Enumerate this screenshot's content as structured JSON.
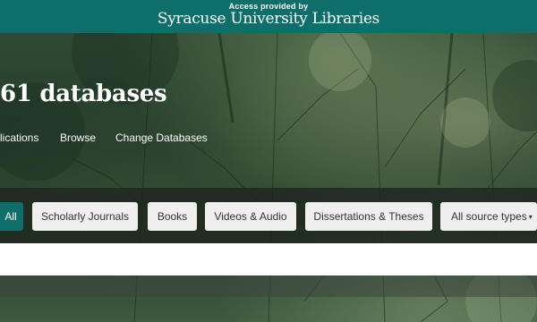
{
  "access": {
    "provided_by": "Access provided by",
    "institution": "Syracuse University Libraries"
  },
  "hero": {
    "title": "61 databases"
  },
  "nav": {
    "items": [
      {
        "label": "lications"
      },
      {
        "label": "Browse"
      },
      {
        "label": "Change Databases"
      }
    ]
  },
  "filters": {
    "items": [
      {
        "label": "All",
        "active": true
      },
      {
        "label": "Scholarly Journals"
      },
      {
        "label": "Books"
      },
      {
        "label": "Videos & Audio"
      },
      {
        "label": "Dissertations & Theses"
      },
      {
        "label": "All source types"
      }
    ],
    "caret": "▾"
  },
  "colors": {
    "brand_teal": "#0d6e6a",
    "chip_bg": "#efefef"
  }
}
